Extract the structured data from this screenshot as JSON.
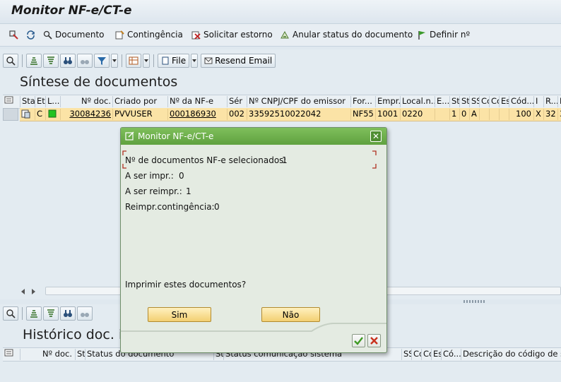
{
  "app": {
    "title": "Monitor NF-e/CT-e"
  },
  "toolbar": {
    "items": [
      {
        "label": "Documento",
        "icon": "document-search-icon"
      },
      {
        "label": "Contingência",
        "icon": "contingency-icon"
      },
      {
        "label": "Solicitar estorno",
        "icon": "reversal-icon"
      },
      {
        "label": "Anular status do documento",
        "icon": "cancel-status-icon"
      },
      {
        "label": "Definir nº",
        "icon": "flag-icon"
      }
    ]
  },
  "synthesis": {
    "title": "Síntese de documentos",
    "file_label": "File",
    "resend_label": "Resend Email",
    "columns": [
      "Sta",
      "Et",
      "L...",
      "Nº doc.",
      "Criado por",
      "Nº da NF-e",
      "Sér",
      "Nº CNPJ/CPF do emissor",
      "For...",
      "Empr...",
      "Local.n...",
      "E...",
      "St",
      "St",
      "SS",
      "Cc",
      "Cc",
      "Es",
      "Cód...",
      "I",
      "R...",
      "R"
    ],
    "row": {
      "status_c": "C",
      "doc_no": "30084236",
      "created_by": "PVVUSER",
      "nfe_no": "000186930",
      "series": "002",
      "cnpj": "33592510022042",
      "form": "NF55",
      "company": "1001",
      "location": "0220",
      "st1": "1",
      "st2": "0",
      "ss": "A",
      "code": "100",
      "i": "X",
      "r": "32",
      "r2": "3"
    }
  },
  "history": {
    "title": "Histórico doc. in",
    "columns": [
      "Nº doc.",
      "St",
      "Status do documento",
      "St",
      "Status comunicação sistema",
      "SS",
      "Cc",
      "Cc",
      "Es",
      "Có...",
      "Descrição do código de st"
    ]
  },
  "dialog": {
    "title": "Monitor NF-e/CT-e",
    "selected_label": "Nº de documentos NF-e selecionados:",
    "selected_value": "1",
    "to_print_label": "A ser impr.:",
    "to_print_value": "0",
    "to_reprint_label": "A ser reimpr.:",
    "to_reprint_value": "1",
    "reprint_contingency_label": "Reimpr.contingência:",
    "reprint_contingency_value": "0",
    "question": "Imprimir estes documentos?",
    "yes_label": "Sim",
    "no_label": "Não"
  }
}
